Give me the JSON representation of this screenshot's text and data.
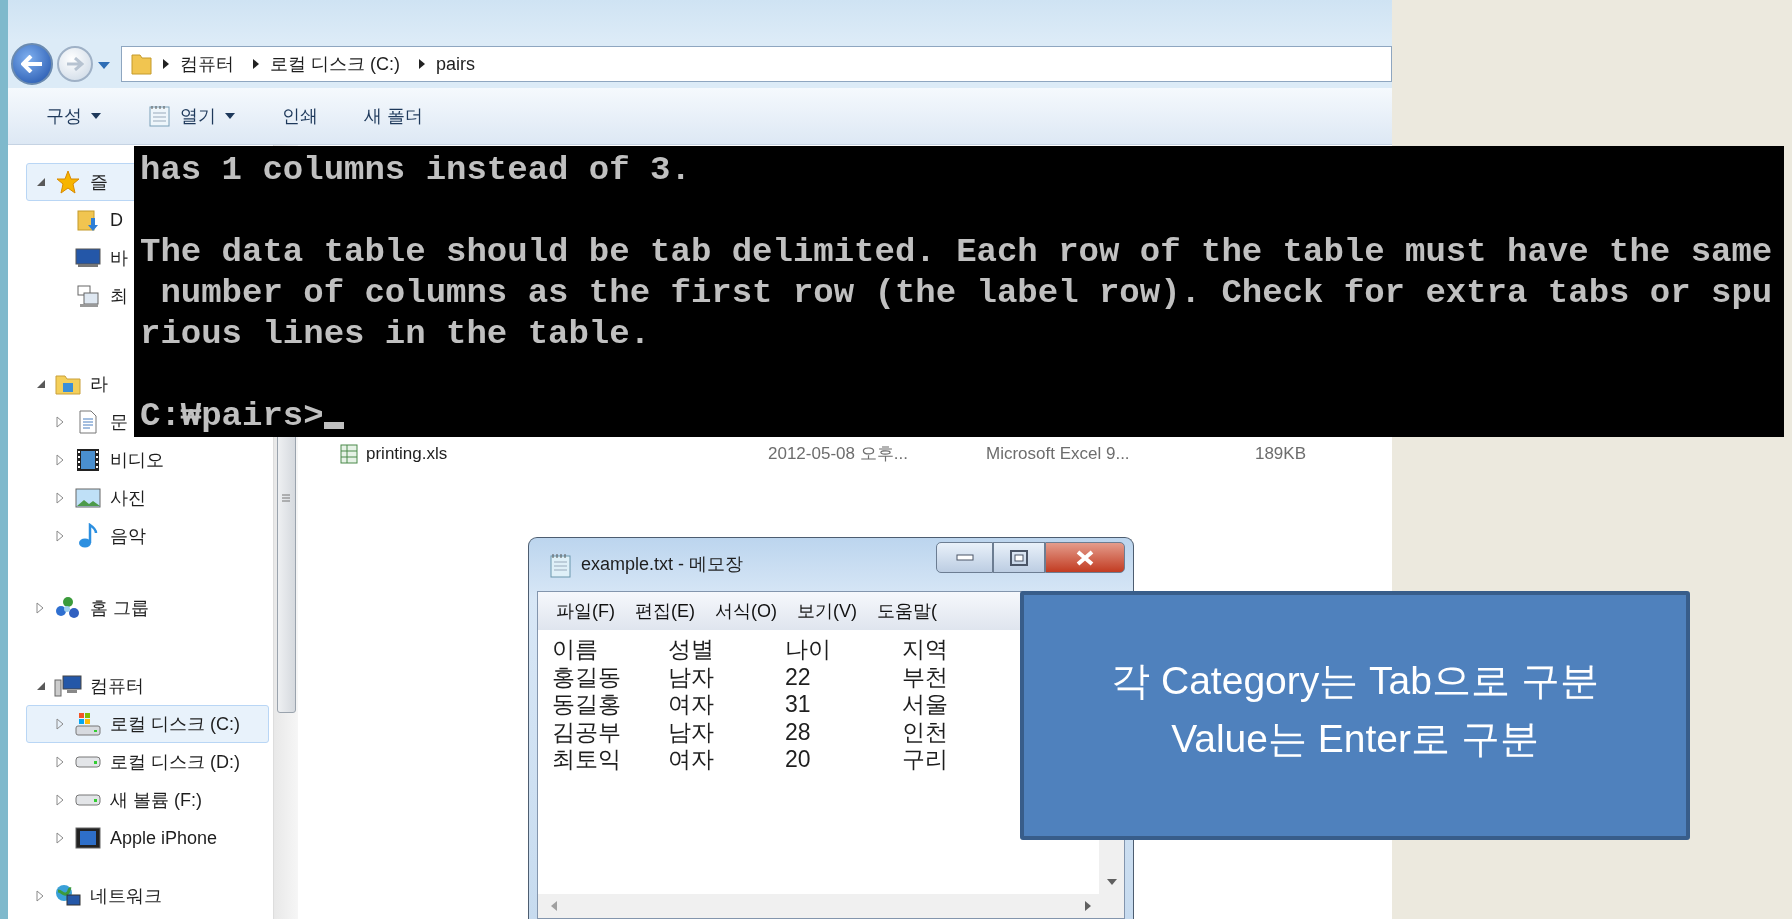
{
  "explorer": {
    "breadcrumb": [
      "컴퓨터",
      "로컬 디스크 (C:)",
      "pairs"
    ],
    "toolbar": [
      {
        "label": "구성",
        "dropdown": true
      },
      {
        "label": "열기",
        "dropdown": true
      },
      {
        "label": "인쇄",
        "dropdown": false
      },
      {
        "label": "새 폴더",
        "dropdown": false
      }
    ],
    "nav": [
      {
        "label": "즐",
        "expanded": true,
        "selected": true,
        "children": [
          {
            "label": "D",
            "selected": false
          },
          {
            "label": "바",
            "selected": false
          },
          {
            "label": "최",
            "selected": false
          }
        ]
      },
      {
        "label": "라",
        "expanded": true,
        "selected": false,
        "children": [
          {
            "label": "문",
            "expanded": false,
            "selected": false
          },
          {
            "label": "비디오",
            "expanded": false,
            "selected": false
          },
          {
            "label": "사진",
            "expanded": false,
            "selected": false
          },
          {
            "label": "음악",
            "expanded": false,
            "selected": false
          }
        ]
      },
      {
        "label": "홈 그룹",
        "expanded": false,
        "selected": false
      },
      {
        "label": "컴퓨터",
        "expanded": true,
        "selected": false,
        "children": [
          {
            "label": "로컬 디스크 (C:)",
            "expanded": false,
            "selected": true
          },
          {
            "label": "로컬 디스크 (D:)",
            "expanded": false,
            "selected": false
          },
          {
            "label": "새 볼륨 (F:)",
            "expanded": false,
            "selected": false
          },
          {
            "label": "Apple iPhone",
            "expanded": false,
            "selected": false
          }
        ]
      },
      {
        "label": "네트워크",
        "expanded": false,
        "selected": false
      }
    ],
    "files": [
      {
        "name": "printing.xls",
        "modified": "2012-05-08 오후...",
        "type": "Microsoft Excel 9...",
        "size": "189KB"
      }
    ]
  },
  "console": {
    "blocks": [
      {
        "lines": [
          "has 1 columns instead of 3."
        ]
      },
      {
        "lines": [
          "The data table should be tab delimited. Each row of the table must have the same",
          " number of columns as the first row (the label row). Check for extra tabs or spu",
          "rious lines in the table."
        ]
      }
    ],
    "prompt": "C:₩pairs>"
  },
  "notepad": {
    "title": "example.txt - 메모장",
    "menu": [
      "파일(F)",
      "편집(E)",
      "서식(O)",
      "보기(V)",
      "도움말("
    ],
    "rows": [
      [
        "이름",
        "성별",
        "나이",
        "지역"
      ],
      [
        "홍길동",
        "남자",
        "22",
        "부천"
      ],
      [
        "동길홍",
        "여자",
        "31",
        "서울"
      ],
      [
        "김공부",
        "남자",
        "28",
        "인천"
      ],
      [
        "최토익",
        "여자",
        "20",
        "구리"
      ]
    ]
  },
  "callout": {
    "lines": [
      "각 Category는 Tab으로 구분",
      "Value는 Enter로 구분"
    ]
  }
}
